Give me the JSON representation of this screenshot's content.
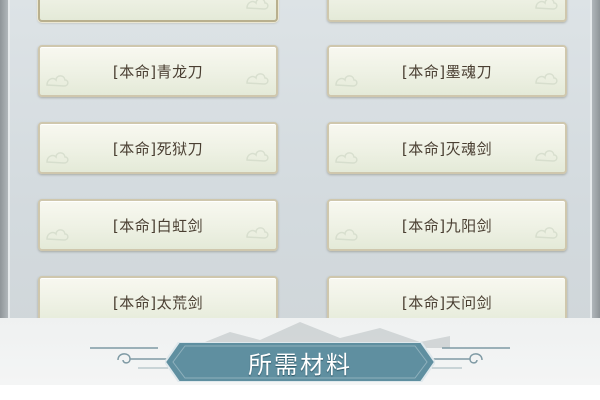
{
  "swords": {
    "left": [
      {
        "label": ""
      },
      {
        "label": "[本命]青龙刀"
      },
      {
        "label": "[本命]死狱刀"
      },
      {
        "label": "[本命]白虹剑"
      },
      {
        "label": "[本命]太荒剑"
      }
    ],
    "right": [
      {
        "label": ""
      },
      {
        "label": "[本命]墨魂刀"
      },
      {
        "label": "[本命]灭魂剑"
      },
      {
        "label": "[本命]九阳剑"
      },
      {
        "label": "[本命]天问剑"
      }
    ]
  },
  "section": {
    "title": "所需材料"
  },
  "colors": {
    "button_border": "#cfc7ad",
    "label_text": "#4a3f32",
    "banner_fill": "#5f8fa0",
    "banner_border": "#dfe8ec"
  }
}
